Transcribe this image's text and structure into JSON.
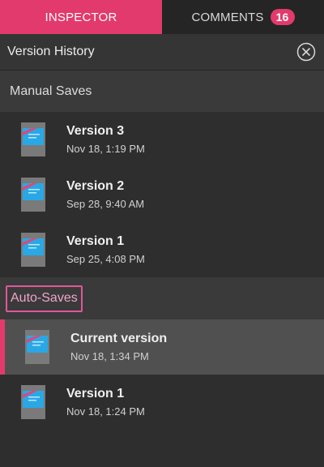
{
  "tabs": [
    {
      "label": "INSPECTOR",
      "active": true
    },
    {
      "label": "COMMENTS",
      "badge": "16",
      "active": false
    }
  ],
  "header": {
    "title": "Version History",
    "close_icon": "close-circle-icon"
  },
  "manual": {
    "title": "Manual Saves",
    "items": [
      {
        "name": "Version 3",
        "date": "Nov 18, 1:19 PM"
      },
      {
        "name": "Version 2",
        "date": "Sep 28, 9:40 AM"
      },
      {
        "name": "Version 1",
        "date": "Sep 25, 4:08 PM"
      }
    ]
  },
  "auto": {
    "title": "Auto-Saves",
    "items": [
      {
        "name": "Current version",
        "date": "Nov 18, 1:34 PM",
        "selected": true
      },
      {
        "name": "Version 1",
        "date": "Nov 18, 1:24 PM"
      }
    ]
  },
  "colors": {
    "accent": "#e23a6c",
    "thumb_blue": "#29a8e6",
    "thumb_gray": "#7a7a7a"
  }
}
